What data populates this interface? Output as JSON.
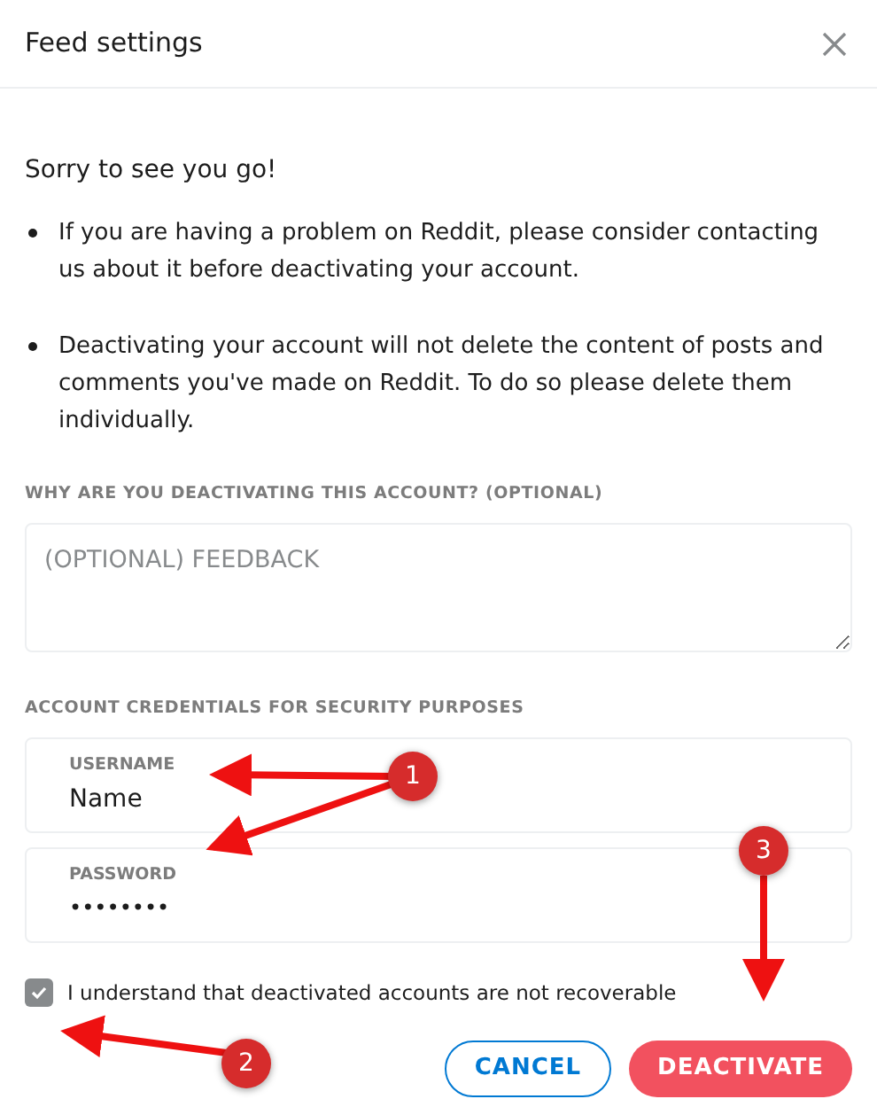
{
  "dialog": {
    "title": "Feed settings"
  },
  "heading": "Sorry to see you go!",
  "bullets": [
    "If you are having a problem on Reddit, please consider contacting us about it before deactivating your account.",
    "Deactivating your account will not delete the content of posts and comments you've made on Reddit. To do so please delete them individually."
  ],
  "feedback": {
    "label": "WHY ARE YOU DEACTIVATING THIS ACCOUNT? (OPTIONAL)",
    "placeholder": "(OPTIONAL) FEEDBACK"
  },
  "credentials": {
    "label": "ACCOUNT CREDENTIALS FOR SECURITY PURPOSES",
    "fields": [
      {
        "label": "USERNAME",
        "value": "Name",
        "kind": "text"
      },
      {
        "label": "PASSWORD",
        "value": "••••••••",
        "kind": "password"
      }
    ]
  },
  "confirm": {
    "label": "I understand that deactivated accounts are not recoverable",
    "checked": true
  },
  "buttons": [
    {
      "label": "CANCEL",
      "kind": "secondary"
    },
    {
      "label": "DEACTIVATE",
      "kind": "primary"
    }
  ],
  "annotations": [
    {
      "label": "1"
    },
    {
      "label": "2"
    },
    {
      "label": "3"
    }
  ]
}
